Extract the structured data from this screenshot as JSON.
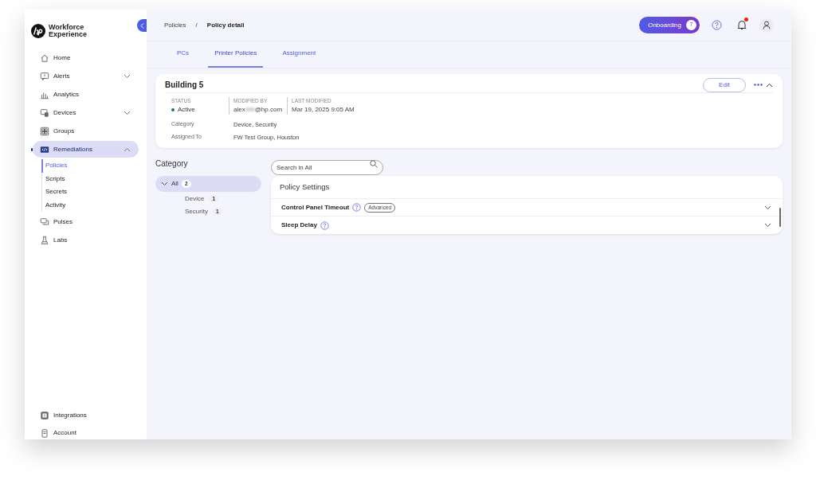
{
  "brand": {
    "name": "Workforce Experience"
  },
  "sidebar": {
    "items": [
      {
        "label": "Home",
        "kind": "plain",
        "selected": false
      },
      {
        "label": "Alerts",
        "kind": "group",
        "selected": false,
        "expanded": false
      },
      {
        "label": "Analytics",
        "kind": "plain",
        "selected": false
      },
      {
        "label": "Devices",
        "kind": "group",
        "selected": false,
        "expanded": false
      },
      {
        "label": "Groups",
        "kind": "plain",
        "selected": false
      },
      {
        "label": "Remediations",
        "kind": "group",
        "selected": true,
        "expanded": true,
        "children": [
          {
            "label": "Policies",
            "selected": true
          },
          {
            "label": "Scripts",
            "selected": false
          },
          {
            "label": "Secrets",
            "selected": false
          },
          {
            "label": "Activity",
            "selected": false
          }
        ]
      },
      {
        "label": "Pulses",
        "kind": "plain",
        "selected": false
      },
      {
        "label": "Labs",
        "kind": "plain",
        "selected": false
      }
    ],
    "bottom_items": [
      {
        "label": "Integrations"
      },
      {
        "label": "Account"
      }
    ]
  },
  "breadcrumb": [
    "Policies",
    "/",
    "Policy detail"
  ],
  "header": {
    "onboarding": {
      "label": "Onboarding",
      "count": "7"
    },
    "notification_unread": true
  },
  "tabs": [
    {
      "label": "PCs",
      "selected": false
    },
    {
      "label": "Printer Policies",
      "selected": true
    },
    {
      "label": "Assignment",
      "selected": false
    }
  ],
  "policy": {
    "title": "Building 5",
    "edit_button": "Edit",
    "status": {
      "label": "STATUS",
      "value": "Active",
      "color": "#1a7f4b"
    },
    "modified_by": {
      "label": "MODIFIED BY",
      "value_start": "alex",
      "value_end": "@hp.com"
    },
    "last_modified": {
      "label": "LAST MODIFIED",
      "value": "Mar 19, 2025 9:05 AM"
    },
    "details": [
      {
        "label": "Category",
        "value": "Device, Security"
      },
      {
        "label": "Assigned To",
        "value": "FW Test Group, Houston"
      }
    ]
  },
  "category": {
    "title": "Category",
    "items": [
      {
        "label": "All",
        "count": "2",
        "selected": true,
        "expanded": true,
        "children": [
          {
            "label": "Device",
            "count": "1",
            "selected": false
          },
          {
            "label": "Security",
            "count": "1",
            "selected": false
          }
        ]
      }
    ]
  },
  "search": {
    "placeholder": "Search in All"
  },
  "settings": {
    "title": "Policy Settings",
    "rows": [
      {
        "label": "Control Panel Timeout",
        "badge": "Advanced",
        "expanded": false
      },
      {
        "label": "Sleep Delay",
        "expanded": false
      }
    ]
  }
}
